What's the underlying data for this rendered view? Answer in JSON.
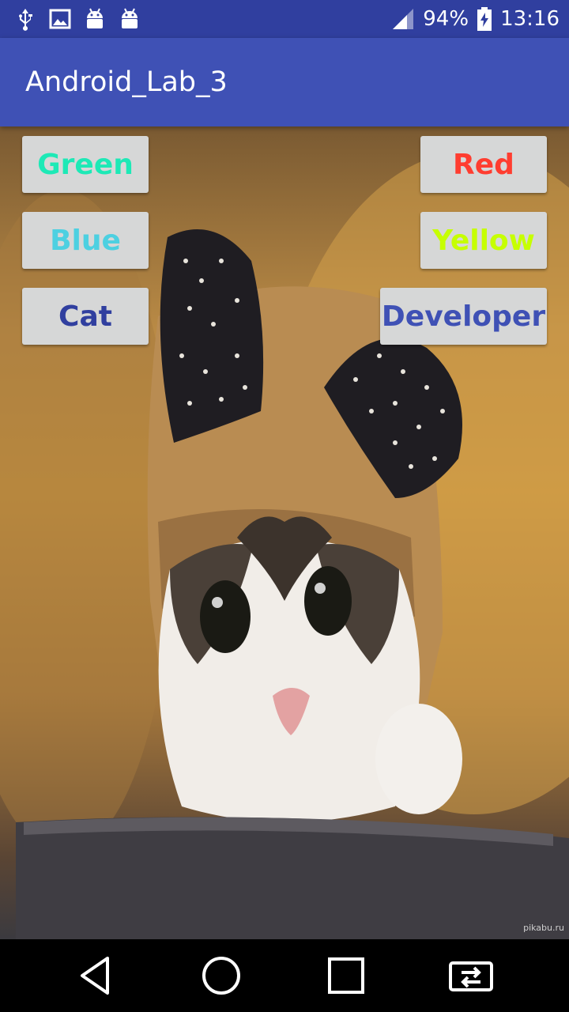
{
  "status_bar": {
    "battery_percent": "94%",
    "time": "13:16",
    "icons": [
      "usb-icon",
      "image-notification-icon",
      "android-icon",
      "android-icon",
      "signal-icon",
      "battery-charging-icon"
    ]
  },
  "app_bar": {
    "title": "Android_Lab_3"
  },
  "buttons": {
    "green": {
      "label": "Green",
      "color": "#1de9b6"
    },
    "red": {
      "label": "Red",
      "color": "#ff3d30"
    },
    "blue": {
      "label": "Blue",
      "color": "#4dd0e1"
    },
    "yellow": {
      "label": "Yellow",
      "color": "#c6ff00"
    },
    "cat": {
      "label": "Cat",
      "color": "#303f9f"
    },
    "developer": {
      "label": "Developer",
      "color": "#3f51b5"
    }
  },
  "background": {
    "watermark": "pikabu.ru"
  },
  "nav_bar": {
    "icons": [
      "back-icon",
      "home-icon",
      "recents-icon",
      "screen-switch-icon"
    ]
  },
  "colors": {
    "status_bar": "#303f9f",
    "app_bar": "#3f51b5",
    "button_bg": "#d6d7d7"
  }
}
